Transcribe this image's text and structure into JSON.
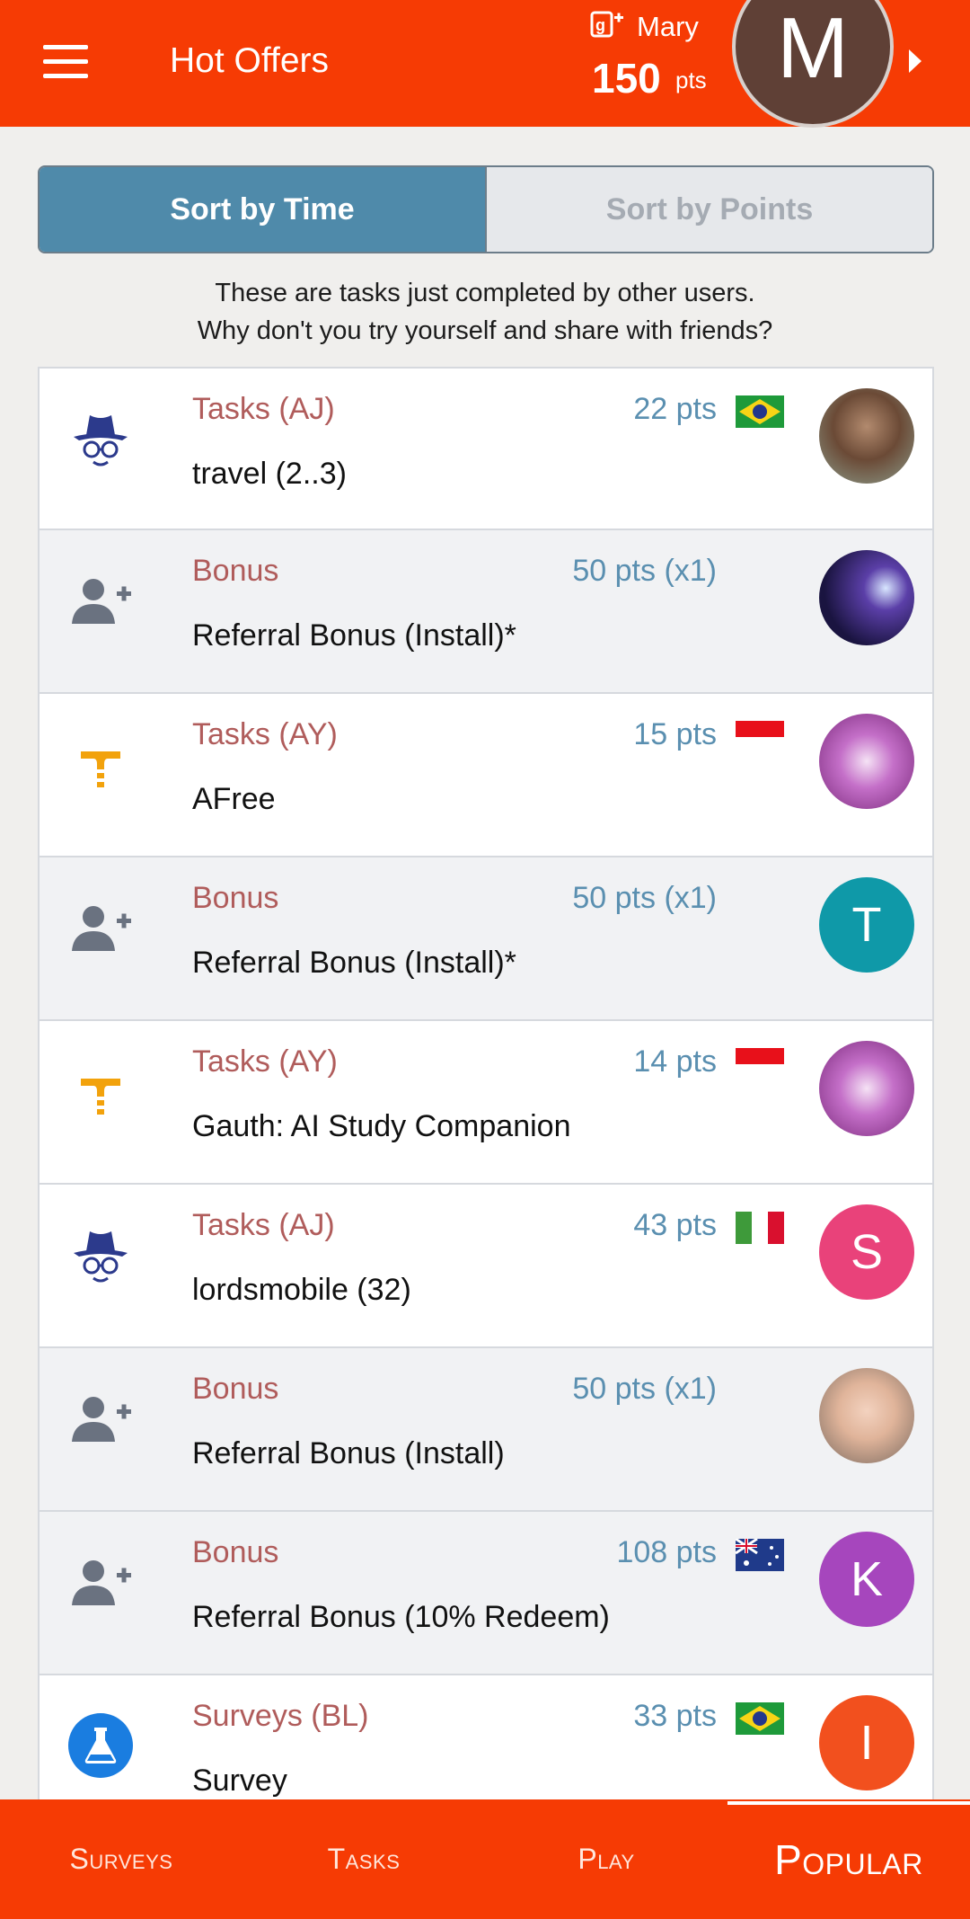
{
  "header": {
    "title": "Hot Offers",
    "user_name": "Mary",
    "points": "150",
    "points_unit": "pts",
    "avatar_letter": "M"
  },
  "sort": {
    "time_label": "Sort by Time",
    "points_label": "Sort by Points"
  },
  "intro": {
    "line1": "These are tasks just completed by other users.",
    "line2": "Why don't you try yourself and share with friends?"
  },
  "rows": [
    {
      "category": "Tasks (AJ)",
      "points": "22 pts",
      "title": "travel (2..3)",
      "icon": "spy-icon",
      "flag": "brazil",
      "avatar": "photo"
    },
    {
      "category": "Bonus",
      "points": "50 pts (x1)",
      "title": "Referral Bonus (Install)*",
      "icon": "add-user-icon",
      "flag": "",
      "avatar": "photo"
    },
    {
      "category": "Tasks (AY)",
      "points": "15 pts",
      "title": "AFree",
      "icon": "ayet-icon",
      "flag": "indonesia",
      "avatar": "photo"
    },
    {
      "category": "Bonus",
      "points": "50 pts (x1)",
      "title": "Referral Bonus (Install)*",
      "icon": "add-user-icon",
      "flag": "",
      "avatar_letter": "T",
      "avatar_color": "#0f99a8"
    },
    {
      "category": "Tasks (AY)",
      "points": "14 pts",
      "title": "Gauth: AI Study Companion",
      "icon": "ayet-icon",
      "flag": "indonesia",
      "avatar": "photo"
    },
    {
      "category": "Tasks (AJ)",
      "points": "43 pts",
      "title": "lordsmobile (32)",
      "icon": "spy-icon",
      "flag": "italy",
      "avatar_letter": "S",
      "avatar_color": "#e9427a"
    },
    {
      "category": "Bonus",
      "points": "50 pts (x1)",
      "title": "Referral Bonus (Install)",
      "icon": "add-user-icon",
      "flag": "",
      "avatar": "photo"
    },
    {
      "category": "Bonus",
      "points": "108 pts",
      "title": "Referral Bonus (10% Redeem)",
      "icon": "add-user-icon",
      "flag": "australia",
      "avatar_letter": "K",
      "avatar_color": "#a646bd"
    },
    {
      "category": "Surveys (BL)",
      "points": "33 pts",
      "title": "Survey",
      "icon": "flask-icon",
      "flag": "brazil",
      "avatar_letter": "I",
      "avatar_color": "#f2501e"
    }
  ],
  "nav": {
    "surveys": "Surveys",
    "tasks": "Tasks",
    "play": "Play",
    "popular": "Popular"
  },
  "colors": {
    "accent": "#f63b04",
    "sort_active": "#4f8aaa",
    "category_text": "#b05c5b",
    "points_text": "#5a8fb0"
  }
}
